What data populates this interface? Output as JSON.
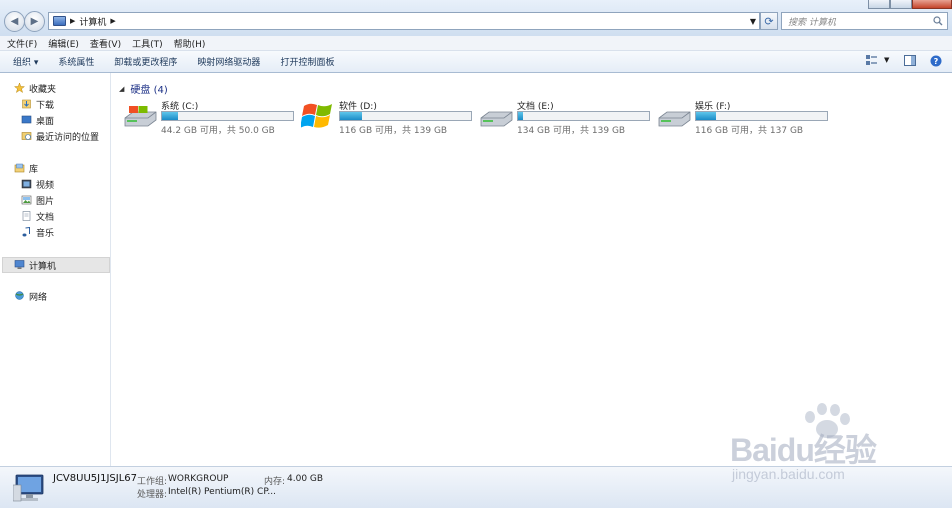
{
  "address": {
    "crumb": "计算机"
  },
  "search": {
    "placeholder": "搜索 计算机"
  },
  "menu": [
    "文件(F)",
    "编辑(E)",
    "查看(V)",
    "工具(T)",
    "帮助(H)"
  ],
  "toolbar": {
    "organize": "组织 ▾",
    "system_props": "系统属性",
    "uninstall": "卸载或更改程序",
    "map_drive": "映射网络驱动器",
    "control_panel": "打开控制面板"
  },
  "sidebar": {
    "favorites": {
      "label": "收藏夹",
      "items": [
        "下载",
        "桌面",
        "最近访问的位置"
      ]
    },
    "libraries": {
      "label": "库",
      "items": [
        "视频",
        "图片",
        "文档",
        "音乐"
      ]
    },
    "computer": "计算机",
    "network": "网络"
  },
  "main": {
    "group_title": "硬盘 (4)",
    "drives": [
      {
        "name": "系统 (C:)",
        "info": "44.2 GB 可用，共 50.0 GB",
        "used_fraction": 0.12
      },
      {
        "name": "软件 (D:)",
        "info": "116 GB 可用，共 139 GB",
        "used_fraction": 0.17
      },
      {
        "name": "文档 (E:)",
        "info": "134 GB 可用，共 139 GB",
        "used_fraction": 0.04
      },
      {
        "name": "娱乐 (F:)",
        "info": "116 GB 可用，共 137 GB",
        "used_fraction": 0.15
      }
    ]
  },
  "details": {
    "computer_name": "JCV8UU5J1JSJL67",
    "workgroup_label": "工作组:",
    "workgroup": "WORKGROUP",
    "memory_label": "内存:",
    "memory": "4.00 GB",
    "processor_label": "处理器:",
    "processor": "Intel(R) Pentium(R) CP..."
  },
  "watermark": {
    "brand": "Baidu经验",
    "url": "jingyan.baidu.com"
  }
}
